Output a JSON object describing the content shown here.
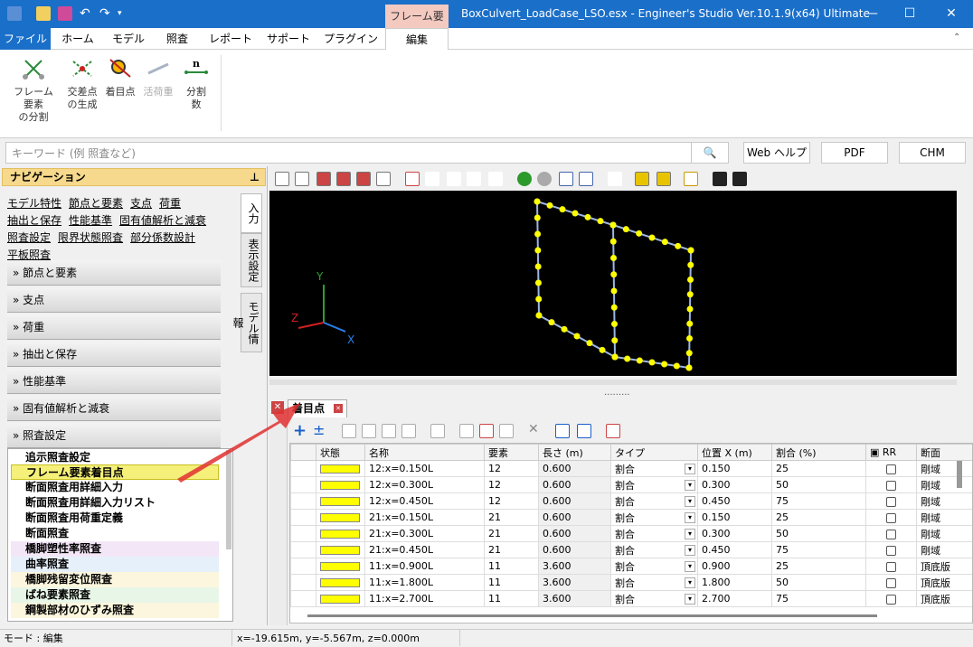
{
  "titlebar": {
    "context_tab": "フレーム要素",
    "title": "BoxCulvert_LoadCase_LSO.esx - Engineer's Studio Ver.10.1.9(x64) Ultimate",
    "minimize": "—",
    "maximize": "☐",
    "close": "✕"
  },
  "ribbon_tabs": [
    "ファイル",
    "ホーム",
    "モデル",
    "照査",
    "レポート",
    "サポート",
    "プラグイン",
    "編集"
  ],
  "ribbon_buttons": [
    {
      "line1": "フレーム要素",
      "line2": "の分割"
    },
    {
      "line1": "交差点",
      "line2": "の生成"
    },
    {
      "line1": "着目点",
      "line2": ""
    },
    {
      "line1": "活荷重",
      "line2": ""
    },
    {
      "line1": "分割",
      "line2": "数"
    }
  ],
  "search": {
    "placeholder": "キーワード (例 照査など)",
    "web_help": "Web ヘルプ",
    "pdf": "PDF",
    "chm": "CHM"
  },
  "nav": {
    "title": "ナビゲーション",
    "pin": "ᵗ",
    "links": [
      [
        "モデル特性",
        "節点と要素",
        "支点",
        "荷重"
      ],
      [
        "抽出と保存",
        "性能基準",
        "固有値解析と減衰"
      ],
      [
        "照査設定",
        "限界状態照査",
        "部分係数設計"
      ],
      [
        "平板照査"
      ]
    ],
    "vtabs": [
      "入力",
      "表示設定",
      "モデル情報"
    ],
    "accordion": [
      "» 節点と要素",
      "» 支点",
      "» 荷重",
      "» 抽出と保存",
      "» 性能基準",
      "» 固有値解析と減衰",
      "» 照査設定"
    ],
    "subitems": [
      "追示照査設定",
      "フレーム要素着目点",
      "断面照査用詳細入力",
      "断面照査用詳細入力リスト",
      "断面照査用荷重定義",
      "断面照査",
      "橋脚塑性率照査",
      "曲率照査",
      "橋脚残留変位照査",
      "ばね要素照査",
      "鋼製部材のひずみ照査"
    ]
  },
  "viewport": {
    "axis_y": "Y",
    "axis_z": "Z",
    "axis_x": "X",
    "splitter": "........."
  },
  "panel": {
    "tab": "着目点"
  },
  "grid": {
    "headers": [
      "状態",
      "名称",
      "要素",
      "長さ (m)",
      "タイプ",
      "位置 X (m)",
      "割合 (%)",
      "RR",
      "断面"
    ],
    "rows": [
      [
        "12:x=0.150L",
        "12",
        "0.600",
        "割合",
        "0.150",
        "25",
        "剛域"
      ],
      [
        "12:x=0.300L",
        "12",
        "0.600",
        "割合",
        "0.300",
        "50",
        "剛域"
      ],
      [
        "12:x=0.450L",
        "12",
        "0.600",
        "割合",
        "0.450",
        "75",
        "剛域"
      ],
      [
        "21:x=0.150L",
        "21",
        "0.600",
        "割合",
        "0.150",
        "25",
        "剛域"
      ],
      [
        "21:x=0.300L",
        "21",
        "0.600",
        "割合",
        "0.300",
        "50",
        "剛域"
      ],
      [
        "21:x=0.450L",
        "21",
        "0.600",
        "割合",
        "0.450",
        "75",
        "剛域"
      ],
      [
        "11:x=0.900L",
        "11",
        "3.600",
        "割合",
        "0.900",
        "25",
        "頂底版"
      ],
      [
        "11:x=1.800L",
        "11",
        "3.600",
        "割合",
        "1.800",
        "50",
        "頂底版"
      ],
      [
        "11:x=2.700L",
        "11",
        "3.600",
        "割合",
        "2.700",
        "75",
        "頂底版"
      ]
    ]
  },
  "status": {
    "mode": "モード : 編集",
    "coords": "x=-19.615m, y=-5.567m, z=0.000m"
  }
}
